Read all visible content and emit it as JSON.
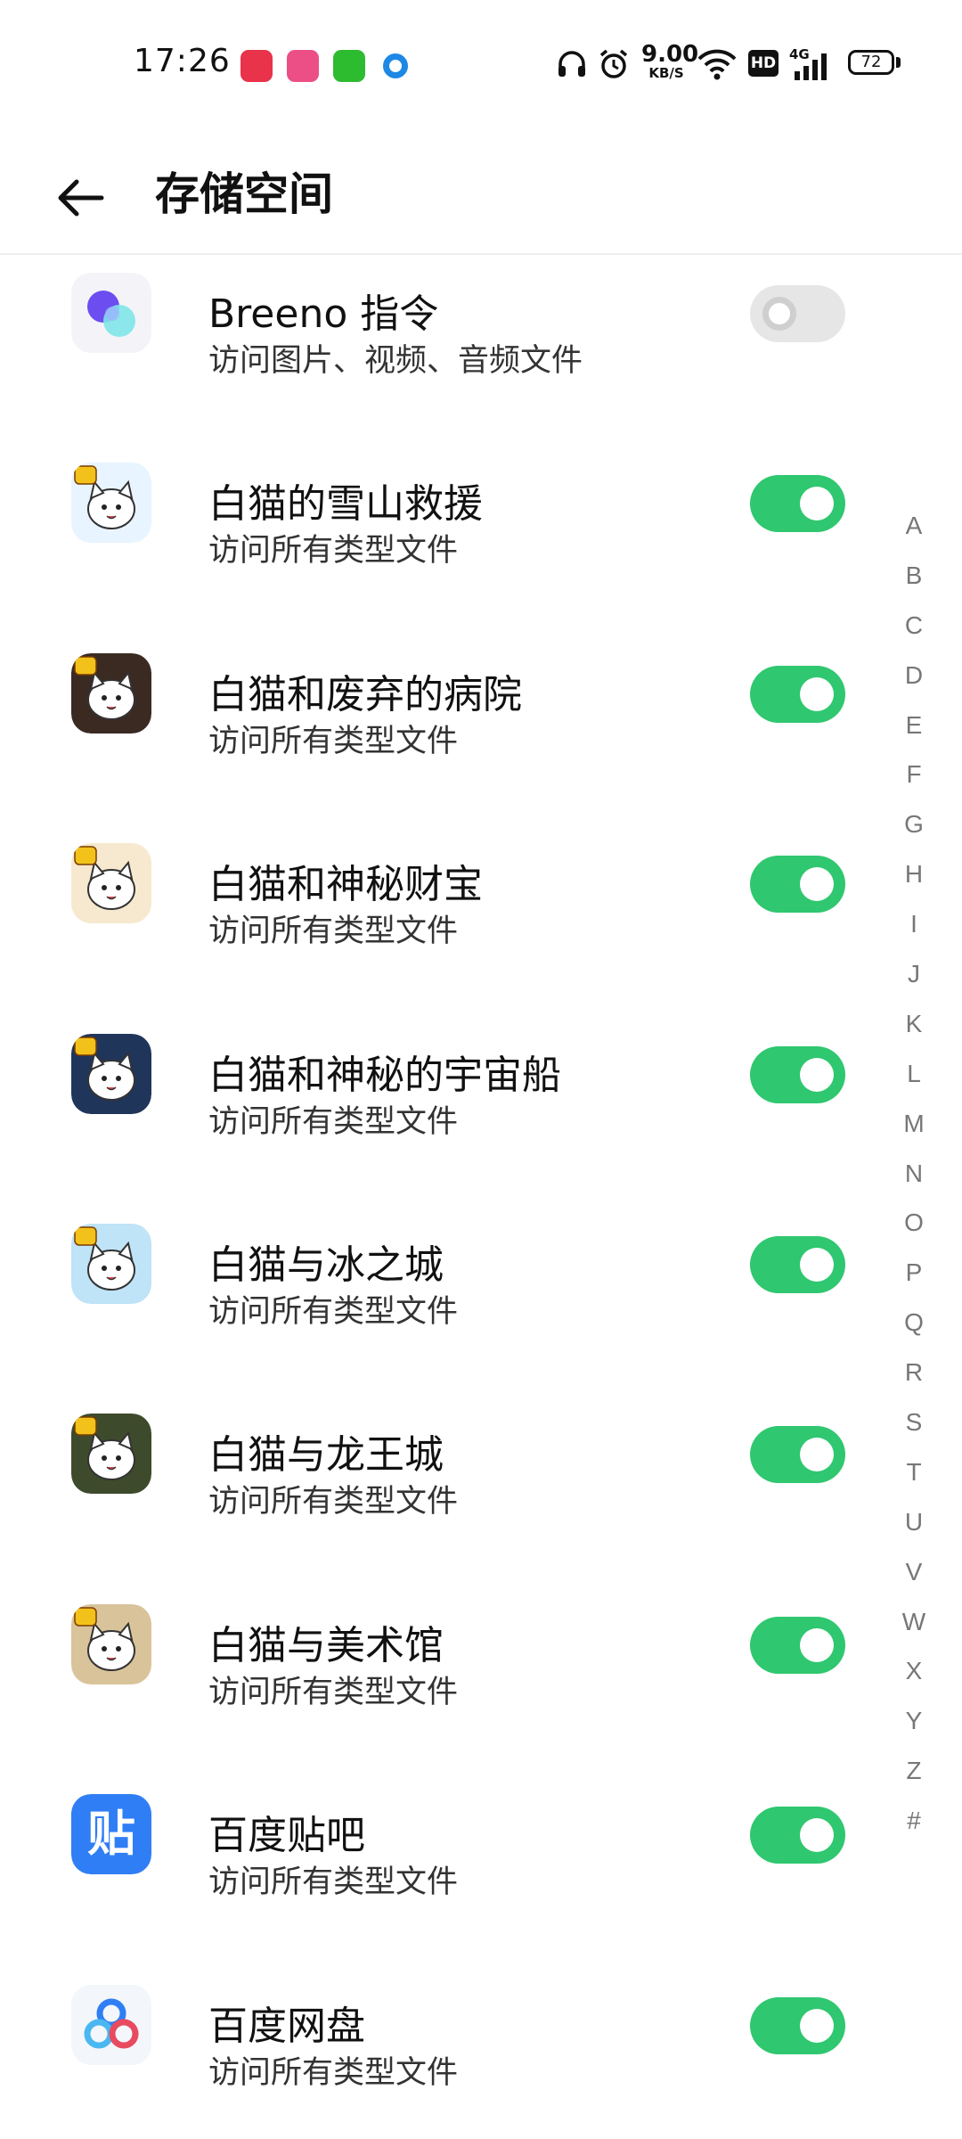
{
  "status_bar": {
    "time": "17:26",
    "net_speed_value": "9.00",
    "net_speed_unit": "KB/S",
    "hd_label": "HD",
    "network_label": "4G",
    "battery_level": "72",
    "app_icons": [
      "video-call-icon",
      "bilibili-icon",
      "iqiyi-icon",
      "blue-ring-icon"
    ]
  },
  "header": {
    "title": "存储空间",
    "back_icon": "arrow-left-icon"
  },
  "apps": [
    {
      "name": "Breeno 指令",
      "subtitle": "访问图片、视频、音频文件",
      "enabled": false,
      "icon": "breeno-icon"
    },
    {
      "name": "白猫的雪山救援",
      "subtitle": "访问所有类型文件",
      "enabled": true,
      "icon": "white-cat-game-icon"
    },
    {
      "name": "白猫和废弃的病院",
      "subtitle": "访问所有类型文件",
      "enabled": true,
      "icon": "white-cat-game-icon"
    },
    {
      "name": "白猫和神秘财宝",
      "subtitle": "访问所有类型文件",
      "enabled": true,
      "icon": "white-cat-game-icon"
    },
    {
      "name": "白猫和神秘的宇宙船",
      "subtitle": "访问所有类型文件",
      "enabled": true,
      "icon": "white-cat-game-icon"
    },
    {
      "name": "白猫与冰之城",
      "subtitle": "访问所有类型文件",
      "enabled": true,
      "icon": "white-cat-game-icon"
    },
    {
      "name": "白猫与龙王城",
      "subtitle": "访问所有类型文件",
      "enabled": true,
      "icon": "white-cat-game-icon"
    },
    {
      "name": "白猫与美术馆",
      "subtitle": "访问所有类型文件",
      "enabled": true,
      "icon": "white-cat-game-icon"
    },
    {
      "name": "百度贴吧",
      "subtitle": "访问所有类型文件",
      "enabled": true,
      "icon": "baidu-tieba-icon",
      "icon_text": "贴"
    },
    {
      "name": "百度网盘",
      "subtitle": "访问所有类型文件",
      "enabled": true,
      "icon": "baidu-netdisk-icon"
    }
  ],
  "index_letters": [
    "A",
    "B",
    "C",
    "D",
    "E",
    "F",
    "G",
    "H",
    "I",
    "J",
    "K",
    "L",
    "M",
    "N",
    "O",
    "P",
    "Q",
    "R",
    "S",
    "T",
    "U",
    "V",
    "W",
    "X",
    "Y",
    "Z",
    "#"
  ],
  "colors": {
    "toggle_on": "#2fc76f",
    "toggle_off": "#e6e6e6",
    "index_text": "#777777",
    "tieba_blue": "#2f7ef5"
  }
}
